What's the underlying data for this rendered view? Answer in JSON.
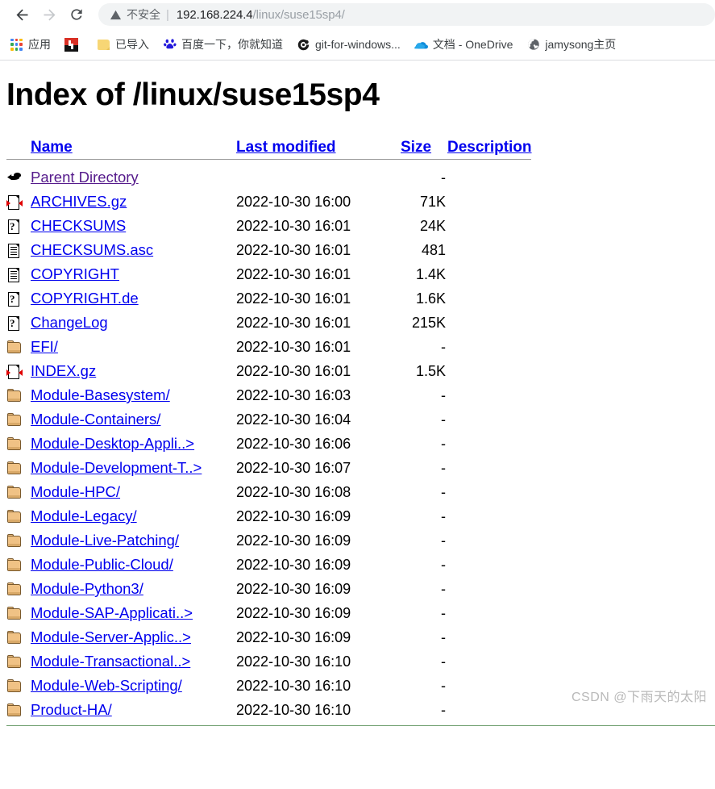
{
  "browser": {
    "back_label": "Back",
    "forward_label": "Forward",
    "reload_label": "Reload",
    "security_text": "不安全",
    "url_host": "192.168.224.4",
    "url_path": "/linux/suse15sp4/",
    "bookmarks": [
      {
        "label": "应用",
        "icon": "apps-grid-icon"
      },
      {
        "label": "",
        "icon": "lenovo-icon"
      },
      {
        "label": "已导入",
        "icon": "folder-icon"
      },
      {
        "label": "百度一下，你就知道",
        "icon": "baidu-icon"
      },
      {
        "label": "git-for-windows...",
        "icon": "git-icon"
      },
      {
        "label": "文档 - OneDrive",
        "icon": "onedrive-cloud-icon"
      },
      {
        "label": "jamysong主页",
        "icon": "globe-icon"
      }
    ]
  },
  "page": {
    "title": "Index of /linux/suse15sp4",
    "watermark": "CSDN @下雨天的太阳",
    "columns": {
      "icon": "",
      "name": "Name",
      "last_modified": "Last modified",
      "size": "Size",
      "description": "Description"
    },
    "rows": [
      {
        "icon": "back-icon",
        "name": "Parent Directory",
        "visited": true,
        "date": "",
        "size": "-",
        "desc": ""
      },
      {
        "icon": "compressed-icon",
        "name": "ARCHIVES.gz",
        "visited": false,
        "date": "2022-10-30 16:00",
        "size": "71K",
        "desc": ""
      },
      {
        "icon": "unknown-icon",
        "name": "CHECKSUMS",
        "visited": false,
        "date": "2022-10-30 16:01",
        "size": "24K",
        "desc": ""
      },
      {
        "icon": "text-icon",
        "name": "CHECKSUMS.asc",
        "visited": false,
        "date": "2022-10-30 16:01",
        "size": "481",
        "desc": ""
      },
      {
        "icon": "text-icon",
        "name": "COPYRIGHT",
        "visited": false,
        "date": "2022-10-30 16:01",
        "size": "1.4K",
        "desc": ""
      },
      {
        "icon": "unknown-icon",
        "name": "COPYRIGHT.de",
        "visited": false,
        "date": "2022-10-30 16:01",
        "size": "1.6K",
        "desc": ""
      },
      {
        "icon": "unknown-icon",
        "name": "ChangeLog",
        "visited": false,
        "date": "2022-10-30 16:01",
        "size": "215K",
        "desc": ""
      },
      {
        "icon": "folder-icon",
        "name": "EFI/",
        "visited": false,
        "date": "2022-10-30 16:01",
        "size": "-",
        "desc": ""
      },
      {
        "icon": "compressed-icon",
        "name": "INDEX.gz",
        "visited": false,
        "date": "2022-10-30 16:01",
        "size": "1.5K",
        "desc": ""
      },
      {
        "icon": "folder-icon",
        "name": "Module-Basesystem/",
        "visited": false,
        "date": "2022-10-30 16:03",
        "size": "-",
        "desc": ""
      },
      {
        "icon": "folder-icon",
        "name": "Module-Containers/",
        "visited": false,
        "date": "2022-10-30 16:04",
        "size": "-",
        "desc": ""
      },
      {
        "icon": "folder-icon",
        "name": "Module-Desktop-Appli..>",
        "visited": false,
        "date": "2022-10-30 16:06",
        "size": "-",
        "desc": ""
      },
      {
        "icon": "folder-icon",
        "name": "Module-Development-T..>",
        "visited": false,
        "date": "2022-10-30 16:07",
        "size": "-",
        "desc": ""
      },
      {
        "icon": "folder-icon",
        "name": "Module-HPC/",
        "visited": false,
        "date": "2022-10-30 16:08",
        "size": "-",
        "desc": ""
      },
      {
        "icon": "folder-icon",
        "name": "Module-Legacy/",
        "visited": false,
        "date": "2022-10-30 16:09",
        "size": "-",
        "desc": ""
      },
      {
        "icon": "folder-icon",
        "name": "Module-Live-Patching/",
        "visited": false,
        "date": "2022-10-30 16:09",
        "size": "-",
        "desc": ""
      },
      {
        "icon": "folder-icon",
        "name": "Module-Public-Cloud/",
        "visited": false,
        "date": "2022-10-30 16:09",
        "size": "-",
        "desc": ""
      },
      {
        "icon": "folder-icon",
        "name": "Module-Python3/",
        "visited": false,
        "date": "2022-10-30 16:09",
        "size": "-",
        "desc": ""
      },
      {
        "icon": "folder-icon",
        "name": "Module-SAP-Applicati..>",
        "visited": false,
        "date": "2022-10-30 16:09",
        "size": "-",
        "desc": ""
      },
      {
        "icon": "folder-icon",
        "name": "Module-Server-Applic..>",
        "visited": false,
        "date": "2022-10-30 16:09",
        "size": "-",
        "desc": ""
      },
      {
        "icon": "folder-icon",
        "name": "Module-Transactional..>",
        "visited": false,
        "date": "2022-10-30 16:10",
        "size": "-",
        "desc": ""
      },
      {
        "icon": "folder-icon",
        "name": "Module-Web-Scripting/",
        "visited": false,
        "date": "2022-10-30 16:10",
        "size": "-",
        "desc": ""
      },
      {
        "icon": "folder-icon",
        "name": "Product-HA/",
        "visited": false,
        "date": "2022-10-30 16:10",
        "size": "-",
        "desc": ""
      }
    ]
  }
}
